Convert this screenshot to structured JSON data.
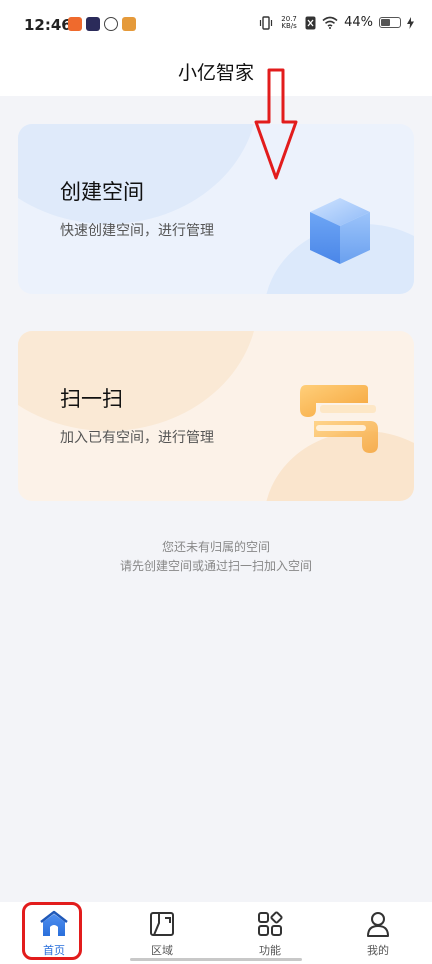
{
  "status_bar": {
    "time": "12:46",
    "net_speed_value": "20.7",
    "net_speed_unit": "KB/s",
    "battery": "44%"
  },
  "header": {
    "title": "小亿智家"
  },
  "cards": {
    "create_space": {
      "title": "创建空间",
      "subtitle": "快速创建空间，进行管理"
    },
    "scan": {
      "title": "扫一扫",
      "subtitle": "加入已有空间，进行管理"
    }
  },
  "empty_state": {
    "line1": "您还未有归属的空间",
    "line2": "请先创建空间或通过扫一扫加入空间"
  },
  "bottom_nav": {
    "items": [
      {
        "label": "首页",
        "icon": "home-icon"
      },
      {
        "label": "区域",
        "icon": "area-icon"
      },
      {
        "label": "功能",
        "icon": "function-icon"
      },
      {
        "label": "我的",
        "icon": "profile-icon"
      }
    ],
    "active_index": 0
  },
  "colors": {
    "accent": "#2a6fdb",
    "annotation": "#e21c1c",
    "create_card_bg": "#ecf2fc",
    "scan_card_bg": "#fcf2e8"
  }
}
